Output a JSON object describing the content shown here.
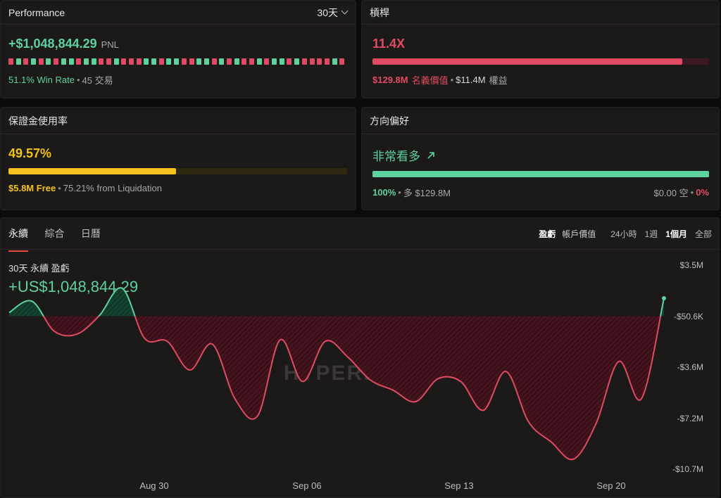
{
  "performance": {
    "title": "Performance",
    "period": "30天",
    "pnl_value": "+$1,048,844.29",
    "pnl_unit": "PNL",
    "win_rate": "51.1% Win Rate",
    "trades": "45 交易",
    "trade_outcomes": [
      "L",
      "W",
      "L",
      "W",
      "L",
      "W",
      "L",
      "W",
      "W",
      "L",
      "W",
      "W",
      "L",
      "L",
      "W",
      "L",
      "L",
      "L",
      "W",
      "W",
      "L",
      "W",
      "W",
      "L",
      "L",
      "W",
      "W",
      "L",
      "W",
      "L",
      "W",
      "L",
      "L",
      "W",
      "L",
      "W",
      "W",
      "L",
      "W",
      "L",
      "L",
      "L",
      "L",
      "W",
      "L"
    ]
  },
  "leverage": {
    "title": "槓桿",
    "value": "11.4X",
    "fill_pct": 92,
    "notional": "$129.8M",
    "notional_label": "名義價值",
    "equity": "$11.4M",
    "equity_label": "權益"
  },
  "margin": {
    "title": "保證金使用率",
    "value": "49.57%",
    "fill_pct": 49.57,
    "free": "$5.8M Free",
    "liquidation": "75.21% from Liquidation"
  },
  "bias": {
    "title": "方向偏好",
    "value": "非常看多",
    "long_pct": "100%",
    "long_label": "多 $129.8M",
    "short_value": "$0.00 空",
    "short_pct": "0%"
  },
  "chart_panel": {
    "tabs": [
      "永續",
      "綜合",
      "日曆"
    ],
    "active_tab": "永續",
    "metric_toggles": [
      "盈虧",
      "帳戶價值"
    ],
    "active_metric": "盈虧",
    "ranges": [
      "24小時",
      "1週",
      "1個月",
      "全部"
    ],
    "active_range": "1個月",
    "caption": "30天 永續 盈虧",
    "headline_value": "+US$1,048,844.29",
    "watermark": "HYPERDASH"
  },
  "colors": {
    "green": "#5fd1a0",
    "red": "#e04b63",
    "yellow": "#f2c11d",
    "card_bg": "#1c1a19"
  },
  "chart_data": {
    "type": "area",
    "x_tick_labels": [
      "Aug 30",
      "Sep 06",
      "Sep 13",
      "Sep 20"
    ],
    "y_tick_labels": [
      "$3.5M",
      "-$50.6K",
      "-$3.6M",
      "-$7.2M",
      "-$10.7M"
    ],
    "ylim": [
      -10.7,
      3.5
    ],
    "y_unit": "M USD",
    "x": [
      "Aug 24",
      "Aug 25",
      "Aug 26",
      "Aug 27",
      "Aug 28",
      "Aug 29",
      "Aug 30",
      "Aug 31",
      "Sep 01",
      "Sep 02",
      "Sep 03",
      "Sep 04",
      "Sep 05",
      "Sep 06",
      "Sep 07",
      "Sep 08",
      "Sep 09",
      "Sep 10",
      "Sep 11",
      "Sep 12",
      "Sep 13",
      "Sep 14",
      "Sep 15",
      "Sep 16",
      "Sep 17",
      "Sep 18",
      "Sep 19",
      "Sep 20",
      "Sep 21",
      "Sep 22"
    ],
    "values": [
      0.2,
      1.0,
      -1.1,
      -1.3,
      0.0,
      1.9,
      -1.6,
      -1.8,
      -3.8,
      -2.0,
      -5.8,
      -7.0,
      -1.7,
      -4.6,
      -1.8,
      -2.9,
      -4.5,
      -5.2,
      -6.0,
      -4.4,
      -4.6,
      -6.6,
      -3.9,
      -7.4,
      -8.8,
      -10.0,
      -7.5,
      -3.2,
      -5.8,
      1.2
    ],
    "baseline": -0.05
  }
}
